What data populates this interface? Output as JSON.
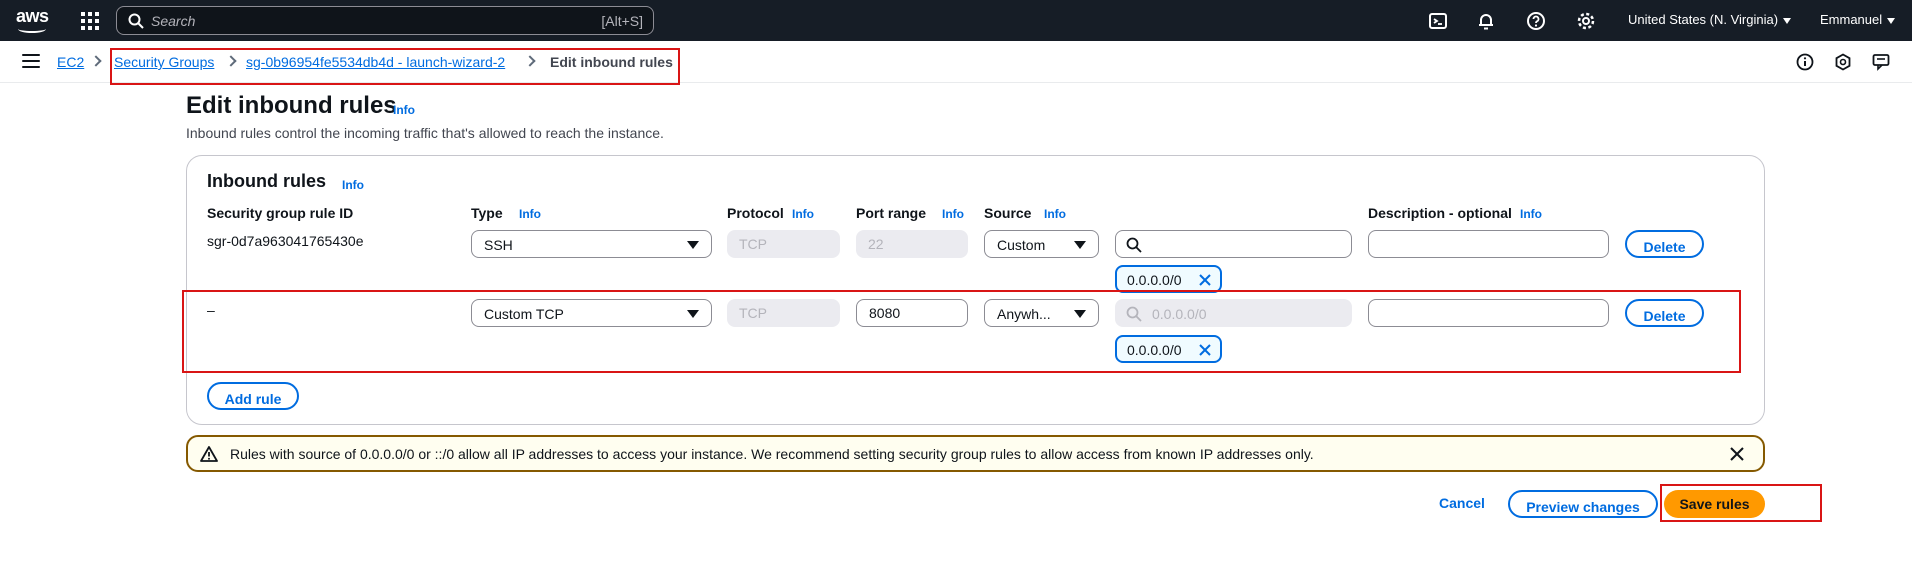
{
  "topnav": {
    "logo_text": "aws",
    "search_placeholder": "Search",
    "search_shortcut": "[Alt+S]",
    "region": "United States (N. Virginia)",
    "user": "Emmanuel"
  },
  "breadcrumb": {
    "items": [
      "EC2",
      "Security Groups",
      "sg-0b96954fe5534db4d - launch-wizard-2"
    ],
    "current": "Edit inbound rules"
  },
  "page": {
    "title": "Edit inbound rules",
    "info": "Info",
    "description": "Inbound rules control the incoming traffic that's allowed to reach the instance."
  },
  "panel": {
    "title": "Inbound rules",
    "info": "Info",
    "columns": {
      "rule_id": "Security group rule ID",
      "type": "Type",
      "protocol": "Protocol",
      "port_range": "Port range",
      "source": "Source",
      "description": "Description - optional"
    },
    "rules": [
      {
        "rule_id": "sgr-0d7a963041765430e",
        "type": "SSH",
        "protocol": "TCP",
        "port_range": "22",
        "source": "Custom",
        "cidr_placeholder": "",
        "token": "0.0.0.0/0",
        "description": "",
        "delete_label": "Delete"
      },
      {
        "rule_id": "–",
        "type": "Custom TCP",
        "protocol": "TCP",
        "port_range": "8080",
        "source": "Anywh...",
        "cidr_placeholder": "0.0.0.0/0",
        "token": "0.0.0.0/0",
        "description": "",
        "delete_label": "Delete"
      }
    ],
    "add_rule_label": "Add rule"
  },
  "warning": {
    "message": "Rules with source of 0.0.0.0/0 or ::/0 allow all IP addresses to access your instance. We recommend setting security group rules to allow access from known IP addresses only."
  },
  "footer": {
    "cancel_label": "Cancel",
    "preview_label": "Preview changes",
    "save_label": "Save rules"
  },
  "colors": {
    "nav_bg": "#161d26",
    "link": "#006ce0",
    "primary": "#ff9900",
    "highlight": "#d91515",
    "warning_border": "#855900"
  }
}
